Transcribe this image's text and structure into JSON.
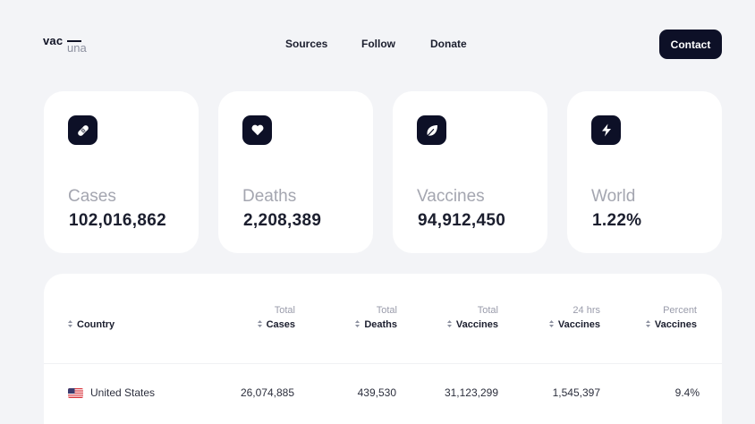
{
  "brand": {
    "logo_top": "vac",
    "logo_bottom": "una"
  },
  "nav": {
    "sources": "Sources",
    "follow": "Follow",
    "donate": "Donate"
  },
  "contact_label": "Contact",
  "stats": [
    {
      "label": "Cases",
      "value": "102,016,862",
      "icon": "bandage-icon"
    },
    {
      "label": "Deaths",
      "value": "2,208,389",
      "icon": "heart-icon"
    },
    {
      "label": "Vaccines",
      "value": "94,912,450",
      "icon": "leaf-icon"
    },
    {
      "label": "World",
      "value": "1.22%",
      "icon": "lightning-icon"
    }
  ],
  "table": {
    "headers": {
      "country": {
        "sup": "",
        "main": "Country"
      },
      "cases": {
        "sup": "Total",
        "main": "Cases"
      },
      "deaths": {
        "sup": "Total",
        "main": "Deaths"
      },
      "vaccines": {
        "sup": "Total",
        "main": "Vaccines"
      },
      "daily": {
        "sup": "24 hrs",
        "main": "Vaccines"
      },
      "percent": {
        "sup": "Percent",
        "main": "Vaccines"
      }
    },
    "rows": [
      {
        "country": "United States",
        "flag": "us-flag-icon",
        "cases": "26,074,885",
        "deaths": "439,530",
        "vaccines": "31,123,299",
        "daily": "1,545,397",
        "percent": "9.4%"
      }
    ]
  },
  "colors": {
    "background": "#f3f4f7",
    "card": "#ffffff",
    "accent_dark": "#0d1027",
    "muted_text": "#a4a6b0"
  }
}
